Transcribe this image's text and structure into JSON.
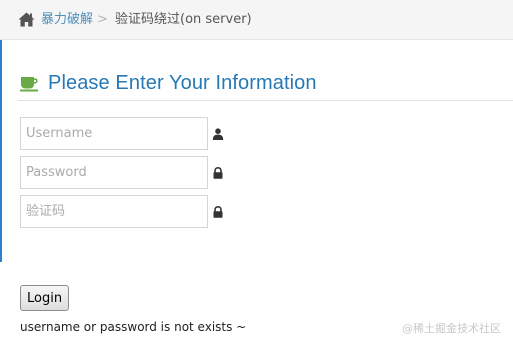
{
  "breadcrumb": {
    "home_icon": "home-icon",
    "parent_label": "暴力破解",
    "separator": ">",
    "current_label": "验证码绕过(on server)"
  },
  "form": {
    "title": "Please Enter Your Information",
    "title_icon": "coffee-icon",
    "username": {
      "placeholder": "Username",
      "value": "",
      "icon": "user-icon"
    },
    "password": {
      "placeholder": "Password",
      "value": "",
      "icon": "lock-icon"
    },
    "captcha": {
      "placeholder": "验证码",
      "value": "",
      "icon": "lock-icon"
    },
    "login_label": "Login",
    "status_message": "username or password is not exists ~"
  },
  "watermark": "@稀土掘金技术社区",
  "colors": {
    "link": "#4c8fbd",
    "title": "#2679b5",
    "coffee_icon": "#69aa46",
    "accent_bar": "#307ecc"
  }
}
